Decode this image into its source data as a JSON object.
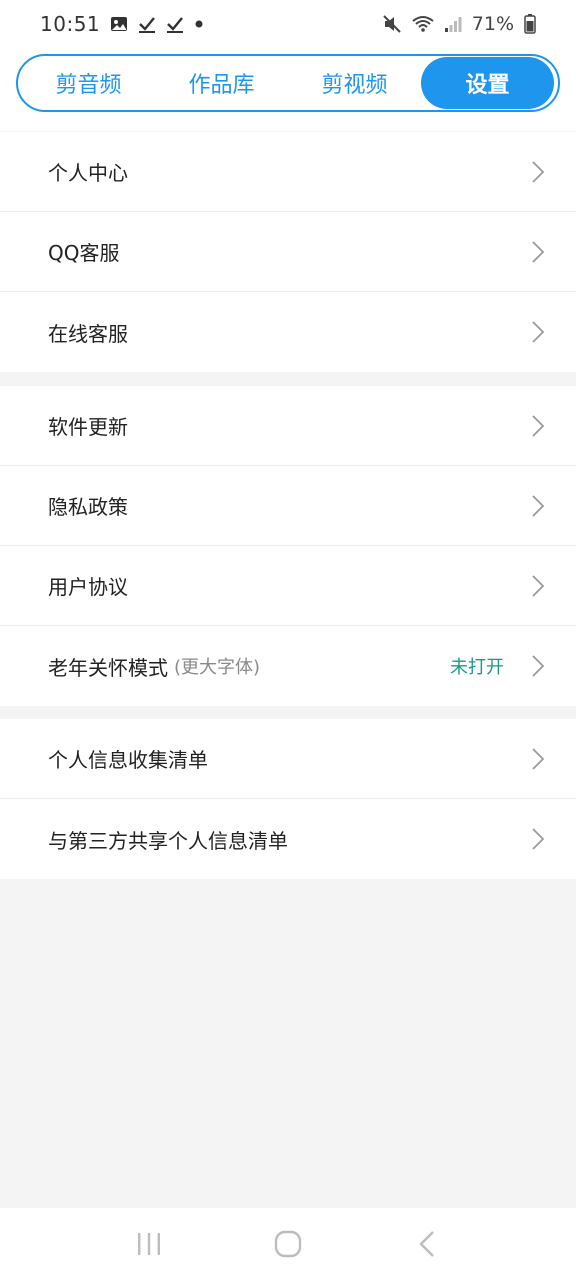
{
  "status_bar": {
    "time": "10:51",
    "left_icons": [
      "image-icon",
      "check-icon",
      "check-icon",
      "dot-icon"
    ],
    "right_icons": [
      "mute-icon",
      "wifi-icon",
      "signal-icon",
      "battery-icon"
    ],
    "battery": "71%"
  },
  "tabs": [
    {
      "label": "剪音频",
      "active": false
    },
    {
      "label": "作品库",
      "active": false
    },
    {
      "label": "剪视频",
      "active": false
    },
    {
      "label": "设置",
      "active": true
    }
  ],
  "sections": [
    {
      "items": [
        {
          "label": "个人中心"
        },
        {
          "label": "QQ客服"
        },
        {
          "label": "在线客服"
        }
      ]
    },
    {
      "items": [
        {
          "label": "软件更新"
        },
        {
          "label": "隐私政策"
        },
        {
          "label": "用户协议"
        },
        {
          "label": "老年关怀模式",
          "sublabel": "(更大字体)",
          "status": "未打开"
        }
      ]
    },
    {
      "items": [
        {
          "label": "个人信息收集清单"
        },
        {
          "label": "与第三方共享个人信息清单"
        }
      ]
    }
  ],
  "colors": {
    "accent": "#1e96ee",
    "status_text": "#1a9a8a",
    "background": "#f4f4f4"
  },
  "nav": [
    "recent-apps-icon",
    "home-icon",
    "back-icon"
  ]
}
